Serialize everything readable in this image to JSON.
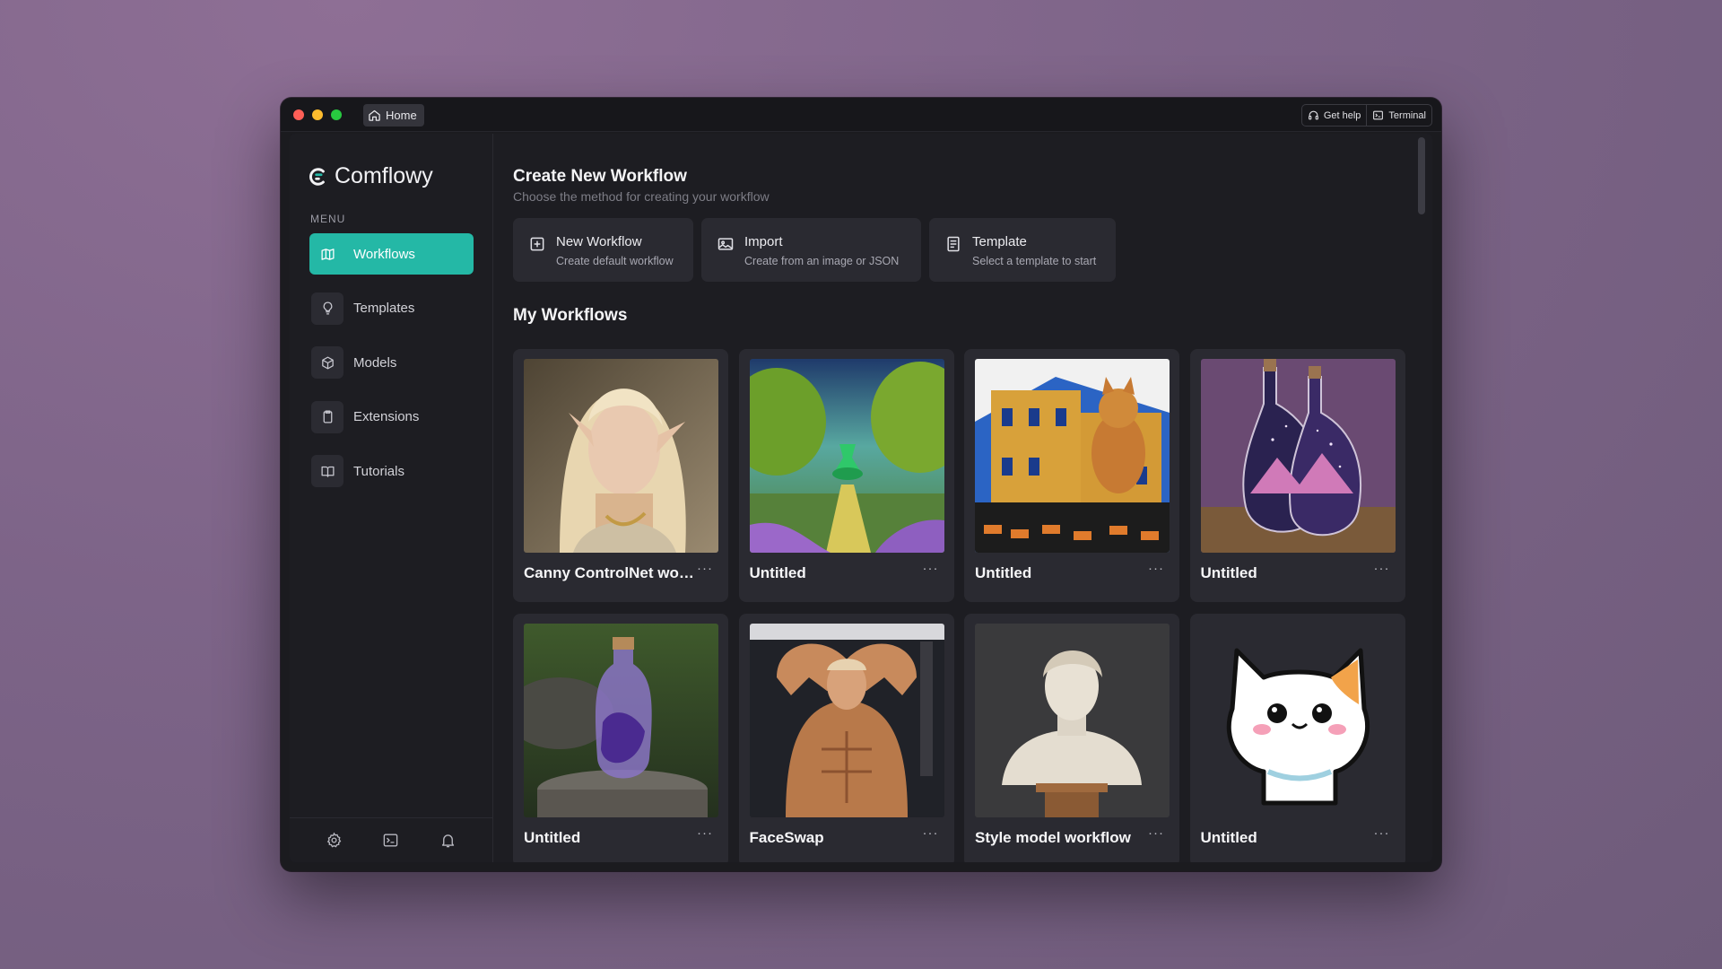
{
  "titlebar": {
    "home_tab": "Home",
    "get_help": "Get help",
    "terminal": "Terminal"
  },
  "sidebar": {
    "app_name": "Comflowy",
    "menu_label": "MENU",
    "items": [
      {
        "label": "Workflows",
        "icon": "map-icon",
        "active": true
      },
      {
        "label": "Templates",
        "icon": "lightbulb-icon"
      },
      {
        "label": "Models",
        "icon": "cube-icon"
      },
      {
        "label": "Extensions",
        "icon": "clipboard-icon"
      },
      {
        "label": "Tutorials",
        "icon": "book-open-icon"
      }
    ],
    "footer_icons": [
      "settings-icon",
      "terminal-icon",
      "bell-icon"
    ]
  },
  "create": {
    "title": "Create New Workflow",
    "subtitle": "Choose the method for creating your workflow",
    "options": [
      {
        "title": "New Workflow",
        "subtitle": "Create default workflow",
        "icon": "plus-square-icon"
      },
      {
        "title": "Import",
        "subtitle": "Create from an image or JSON",
        "icon": "image-icon"
      },
      {
        "title": "Template",
        "subtitle": "Select a template to start",
        "icon": "document-icon"
      }
    ]
  },
  "workflows": {
    "title": "My Workflows",
    "more": "···",
    "items": [
      {
        "name": "Canny ControlNet workflow",
        "thumb": "elf-woman-portrait"
      },
      {
        "name": "Untitled",
        "thumb": "potion-forest-path"
      },
      {
        "name": "Untitled",
        "thumb": "cat-on-building"
      },
      {
        "name": "Untitled",
        "thumb": "galaxy-bottle"
      },
      {
        "name": "Untitled",
        "thumb": "purple-bottle-on-stump"
      },
      {
        "name": "FaceSwap",
        "thumb": "bodybuilder"
      },
      {
        "name": "Style model workflow",
        "thumb": "marble-bust"
      },
      {
        "name": "Untitled",
        "thumb": "cat-sticker"
      }
    ]
  },
  "colors": {
    "accent": "#24b8a6",
    "background": "#1d1d22",
    "card": "#2a2a31"
  }
}
